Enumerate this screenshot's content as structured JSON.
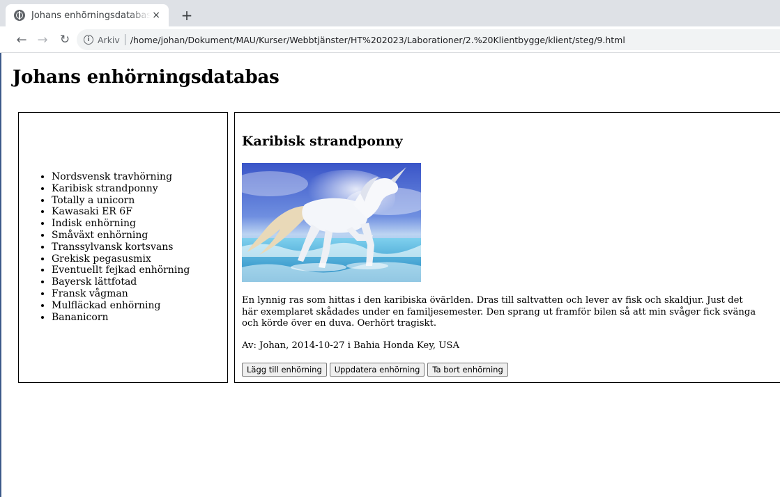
{
  "browser": {
    "tab_title": "Johans enhörningsdatabas",
    "tab_close": "×",
    "new_tab": "+",
    "scheme_label": "Arkiv",
    "url": "/home/johan/Dokument/MAU/Kurser/Webbtjänster/HT%202023/Laborationer/2.%20Klientbygge/klient/steg/9.html"
  },
  "page": {
    "title": "Johans enhörningsdatabas"
  },
  "unicorn_list": {
    "items": [
      "Nordsvensk travhörning",
      "Karibisk strandponny",
      "Totally a unicorn",
      "Kawasaki ER 6F",
      "Indisk enhörning",
      "Småväxt enhörning",
      "Transsylvansk kortsvans",
      "Grekisk pegasusmix",
      "Eventuellt fejkad enhörning",
      "Bayersk lättfotad",
      "Fransk vågman",
      "Mulfläckad enhörning",
      "Bananicorn"
    ]
  },
  "detail": {
    "name": "Karibisk strandponny",
    "description": "En lynnig ras som hittas i den karibiska övärlden. Dras till saltvatten och lever av fisk och skaldjur. Just det här exemplaret skådades under en familjesemester. Den sprang ut framför bilen så att min svåger fick svänga och körde över en duva. Oerhört tragiskt.",
    "author_line": "Av: Johan, 2014-10-27 i Bahia Honda Key, USA",
    "buttons": {
      "add": "Lägg till enhörning",
      "update": "Uppdatera enhörning",
      "delete": "Ta bort enhörning"
    }
  }
}
